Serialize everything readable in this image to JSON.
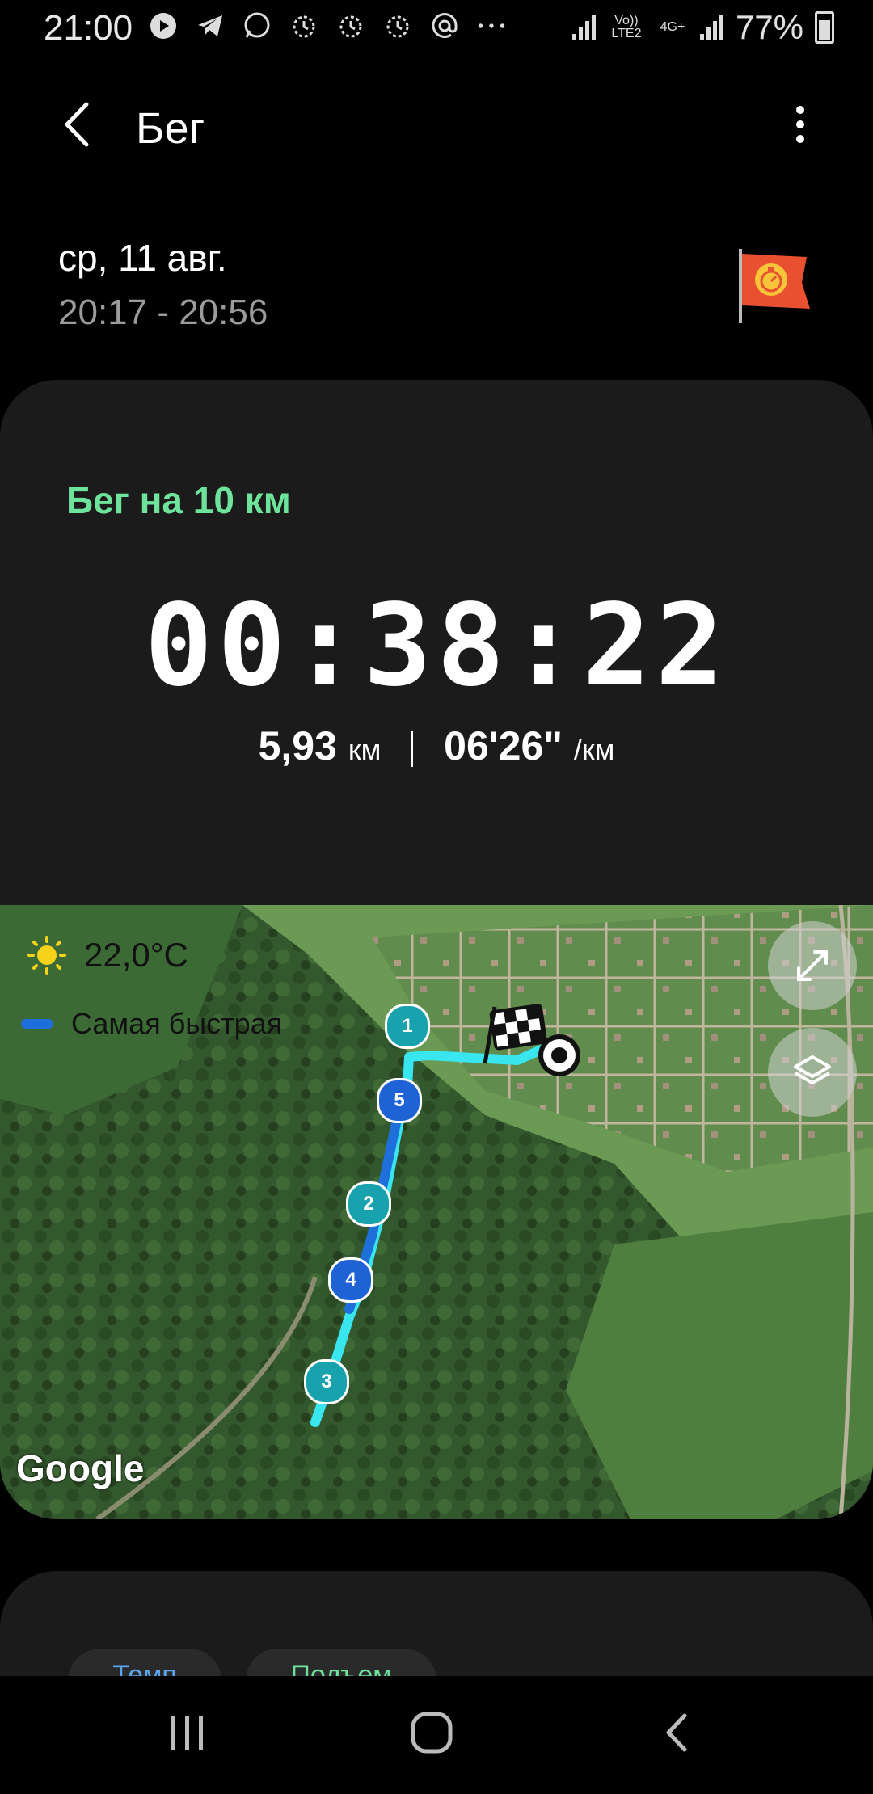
{
  "status_bar": {
    "time": "21:00",
    "icons": [
      "play-icon",
      "telegram-icon",
      "whatsapp-icon",
      "alarm-icon",
      "alarm-icon",
      "alarm-icon",
      "at-icon",
      "more-dots-icon"
    ],
    "network_1": "Vo)) LTE2",
    "network_2": "4G+",
    "battery": "77%"
  },
  "header": {
    "title": "Бег"
  },
  "session": {
    "date": "ср, 11 авг.",
    "time_range": "20:17 - 20:56"
  },
  "workout": {
    "name": "Бег на 10 км",
    "duration": "00:38:22",
    "distance": "5,93",
    "distance_unit": "км",
    "pace": "06'26\"",
    "pace_unit": "/км"
  },
  "map": {
    "temperature": "22,0°C",
    "legend_label": "Самая быстрая",
    "km_markers": [
      "1",
      "5",
      "2",
      "4",
      "3"
    ],
    "attribution": "Google",
    "colors": {
      "route_main": "#39e5ee",
      "route_fast": "#1e6fd9",
      "marker_teal": "#17a2ad",
      "marker_blue": "#1e62d6"
    }
  },
  "tabs": {
    "pace": "Темп",
    "elevation": "Подъем"
  },
  "colors": {
    "accent_green": "#6ee39b",
    "accent_blue": "#5aa6f0",
    "card_bg": "#1b1b1b"
  }
}
